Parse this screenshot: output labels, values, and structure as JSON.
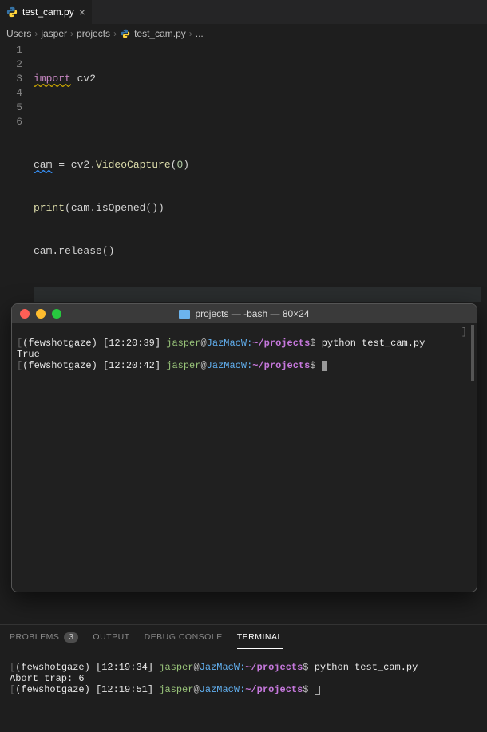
{
  "tab": {
    "filename": "test_cam.py"
  },
  "breadcrumb": {
    "parts": [
      "Users",
      "jasper",
      "projects",
      "test_cam.py",
      "..."
    ]
  },
  "editor": {
    "lines": {
      "l1": {
        "import": "import",
        "mod": "cv2"
      },
      "l3": {
        "var": "cam",
        "assign": " = cv2.",
        "call": "VideoCapture",
        "lp": "(",
        "arg": "0",
        "rp": ")"
      },
      "l4": {
        "fn": "print",
        "rest": "(cam.isOpened())"
      },
      "l5": {
        "text": "cam.release()"
      }
    },
    "line_numbers": [
      "1",
      "2",
      "3",
      "4",
      "5",
      "6"
    ]
  },
  "mac_terminal": {
    "title": "projects — -bash — 80×24",
    "lines": [
      {
        "env": "(fewshotgaze)",
        "time": "[12:20:39]",
        "user": "jasper",
        "at": "@",
        "host": "JazMacW:",
        "path": "~/projects",
        "dollar": "$",
        "cmd": " python test_cam.py"
      },
      {
        "output": "True"
      },
      {
        "env": "(fewshotgaze)",
        "time": "[12:20:42]",
        "user": "jasper",
        "at": "@",
        "host": "JazMacW:",
        "path": "~/projects",
        "dollar": "$",
        "cmd": " "
      }
    ]
  },
  "panel": {
    "tabs": {
      "problems": "PROBLEMS",
      "problems_count": "3",
      "output": "OUTPUT",
      "debug": "DEBUG CONSOLE",
      "terminal": "TERMINAL"
    },
    "lines": [
      {
        "env": "(fewshotgaze)",
        "time": "[12:19:34]",
        "user": "jasper",
        "at": "@",
        "host": "JazMacW:",
        "path": "~/projects",
        "dollar": "$",
        "cmd": " python test_cam.py"
      },
      {
        "output": "Abort trap: 6"
      },
      {
        "env": "(fewshotgaze)",
        "time": "[12:19:51]",
        "user": "jasper",
        "at": "@",
        "host": "JazMacW:",
        "path": "~/projects",
        "dollar": "$",
        "cmd": " "
      }
    ]
  }
}
